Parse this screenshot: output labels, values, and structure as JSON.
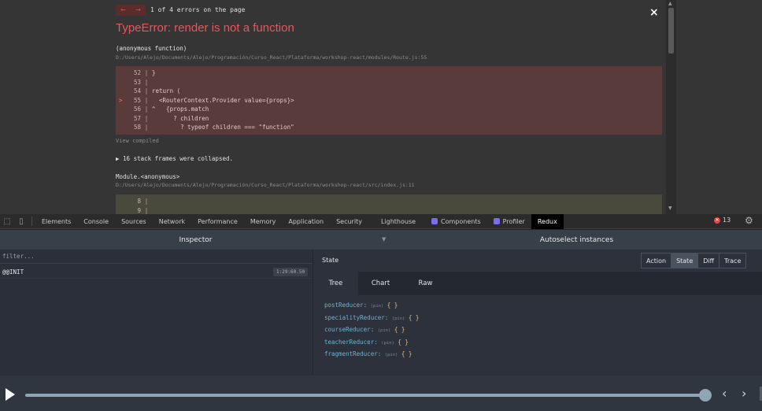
{
  "overlay": {
    "nav_prev": "←",
    "nav_next": "→",
    "error_count": "1 of 4 errors on the page",
    "close": "×",
    "title": "TypeError: render is not a function",
    "frame1": {
      "name": "(anonymous function)",
      "path": "D:/Users/Alejo/Documents/Alejo/Programación/Curso_React/Plataforma/workshop-react/modules/Route.js:55",
      "lines": [
        {
          "n": "52",
          "code": "}",
          "mark": ""
        },
        {
          "n": "53",
          "code": "",
          "mark": ""
        },
        {
          "n": "54",
          "code": "return (",
          "mark": ""
        },
        {
          "n": "55",
          "code": "  <RouterContext.Provider value={props}>",
          "mark": ">"
        },
        {
          "n": "56",
          "code": "^   {props.match",
          "mark": ""
        },
        {
          "n": "57",
          "code": "      ? children",
          "mark": ""
        },
        {
          "n": "58",
          "code": "        ? typeof children === \"function\"",
          "mark": ""
        }
      ]
    },
    "view_compiled": "View compiled",
    "collapsed": "▶ 16 stack frames were collapsed.",
    "frame2": {
      "name": "Module.<anonymous>",
      "path": "D:/Users/Alejo/Documents/Alejo/Programación/Curso_React/Plataforma/workshop-react/src/index.js:11",
      "lines": [
        {
          "n": "8",
          "code": ""
        },
        {
          "n": "9",
          "code": ""
        }
      ]
    }
  },
  "devtools": {
    "tabs": [
      "Elements",
      "Console",
      "Sources",
      "Network",
      "Performance",
      "Memory",
      "Application",
      "Security",
      "Lighthouse"
    ],
    "ext_tabs": [
      "Components",
      "Profiler"
    ],
    "active_tab": "Redux",
    "error_badge": "13"
  },
  "redux": {
    "inspector_label": "Inspector",
    "autoselect_label": "Autoselect instances",
    "filter_placeholder": "filter...",
    "actions": [
      {
        "name": "@@INIT",
        "time": "1:29:60.50"
      }
    ],
    "state_label": "State",
    "mode_buttons": [
      "Action",
      "State",
      "Diff",
      "Trace"
    ],
    "active_mode": "State",
    "subtabs": [
      "Tree",
      "Chart",
      "Raw"
    ],
    "active_subtab": "Tree",
    "tree": [
      {
        "key": "postReducer",
        "type": "(pin)",
        "value": "{ }"
      },
      {
        "key": "specialityReducer",
        "type": "(pin)",
        "value": "{ }"
      },
      {
        "key": "courseReducer",
        "type": "(pin)",
        "value": "{ }"
      },
      {
        "key": "teacherReducer",
        "type": "(pin)",
        "value": "{ }"
      },
      {
        "key": "fragmentReducer",
        "type": "(pin)",
        "value": "{ }"
      }
    ]
  },
  "slider": {
    "position": 1.0,
    "prev": "‹",
    "next": "›"
  }
}
